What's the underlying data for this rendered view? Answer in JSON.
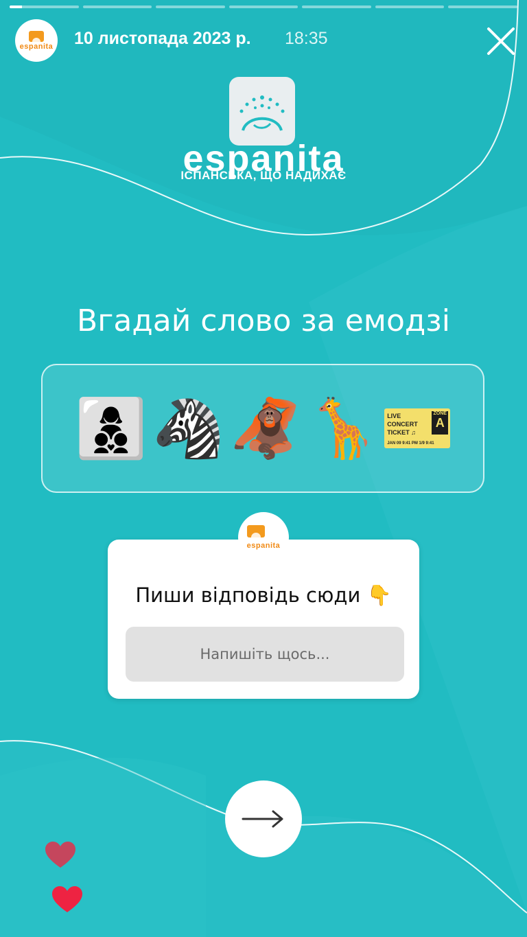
{
  "header": {
    "date": "10 листопада 2023 р.",
    "time": "18:35",
    "close_icon": "close-icon",
    "progress_segments": 7,
    "active_segment": 0,
    "active_progress": 0.18
  },
  "brand": {
    "name": "espanita",
    "tagline": "ІСПАНСЬКА, ЩО НАДИХАЄ",
    "accent": "#f39a1e"
  },
  "story": {
    "title": "Вгадай слово за емодзі",
    "emojis": [
      "👩‍👦‍👦",
      "🦓",
      "🦧",
      "🦒"
    ],
    "ticket": {
      "line1": "LIVE",
      "line2": "CONCERT",
      "line3": "TICKET ♫",
      "zone_label": "ZONE",
      "zone": "A",
      "footer": "JAN 09  9:41 PM    1/9  9:41"
    }
  },
  "question": {
    "prompt": "Пиши відповідь сюди 👇",
    "placeholder": "Напишіть щось..."
  },
  "actions": {
    "next_icon": "arrow-right-icon",
    "heart_icon": "heart-icon"
  },
  "colors": {
    "background": "#21bcc2",
    "heart": "#e8304a"
  }
}
